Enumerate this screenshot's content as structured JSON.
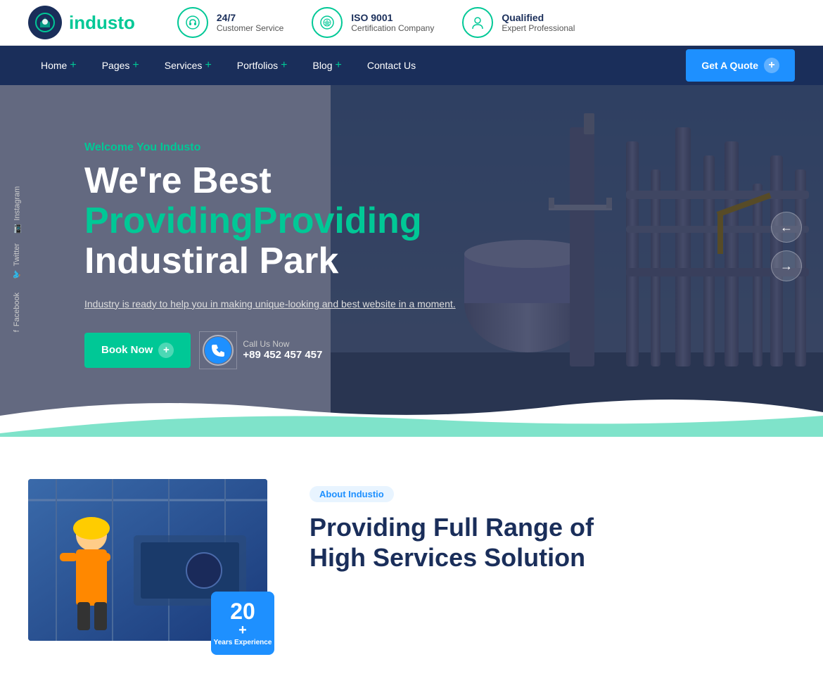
{
  "topbar": {
    "logo_text_main": "indust",
    "logo_text_accent": "o",
    "feature1_line1": "24/7",
    "feature1_line2": "Customer Service",
    "feature2_line1": "ISO 9001",
    "feature2_line2": "Certification Company",
    "feature3_line1": "Qualified",
    "feature3_line2": "Expert Professional"
  },
  "navbar": {
    "items": [
      {
        "label": "Home",
        "has_plus": true
      },
      {
        "label": "Pages",
        "has_plus": true
      },
      {
        "label": "Services",
        "has_plus": true
      },
      {
        "label": "Portfolios",
        "has_plus": true
      },
      {
        "label": "Blog",
        "has_plus": true
      },
      {
        "label": "Contact Us",
        "has_plus": false
      }
    ],
    "cta_label": "Get A Quote"
  },
  "hero": {
    "welcome_text": "Welcome You",
    "welcome_brand": "Industo",
    "title_line1": "We're Best",
    "title_highlight": "Providing",
    "title_line2": "Industiral Park",
    "description": "Industry is ready to help you in making unique-looking and best website in a moment.",
    "book_btn": "Book Now",
    "call_label": "Call Us Now",
    "phone": "+89 452 457 457",
    "arrow_prev": "←",
    "arrow_next": "→"
  },
  "social": [
    {
      "label": "Instagram",
      "icon": "📷"
    },
    {
      "label": "Twitter",
      "icon": "🐦"
    },
    {
      "label": "Facebook",
      "icon": "f"
    }
  ],
  "below": {
    "tag": "About Industio",
    "title_line1": "Providing Full Range of",
    "title_line2": "High Services Solution",
    "badge_number": "20",
    "badge_plus": "+",
    "badge_label": "Years Experience"
  }
}
